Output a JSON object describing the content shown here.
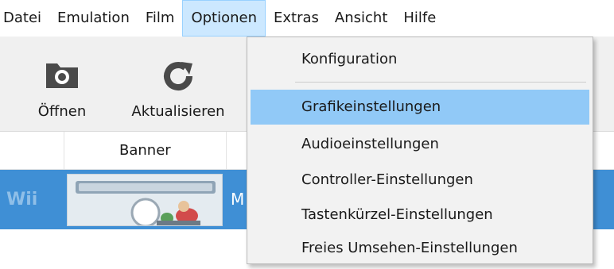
{
  "menubar": {
    "items": [
      "Datei",
      "Emulation",
      "Film",
      "Optionen",
      "Extras",
      "Ansicht",
      "Hilfe"
    ],
    "active": "Optionen"
  },
  "toolbar": {
    "open_label": "Öffnen",
    "refresh_label": "Aktualisieren"
  },
  "list": {
    "banner_header": "Banner",
    "row": {
      "platform": "Wii",
      "title_partial": "M"
    }
  },
  "options_menu": {
    "items": [
      "Konfiguration",
      "Grafikeinstellungen",
      "Audioeinstellungen",
      "Controller-Einstellungen",
      "Tastenkürzel-Einstellungen",
      "Freies Umsehen-Einstellungen"
    ],
    "highlighted": "Grafikeinstellungen"
  },
  "colors": {
    "menu_active_bg": "#cce8ff",
    "highlight": "#91c9f7",
    "row_selected": "#3f8fd5"
  },
  "icons": {
    "open": "camera-folder-icon",
    "refresh": "refresh-icon"
  }
}
